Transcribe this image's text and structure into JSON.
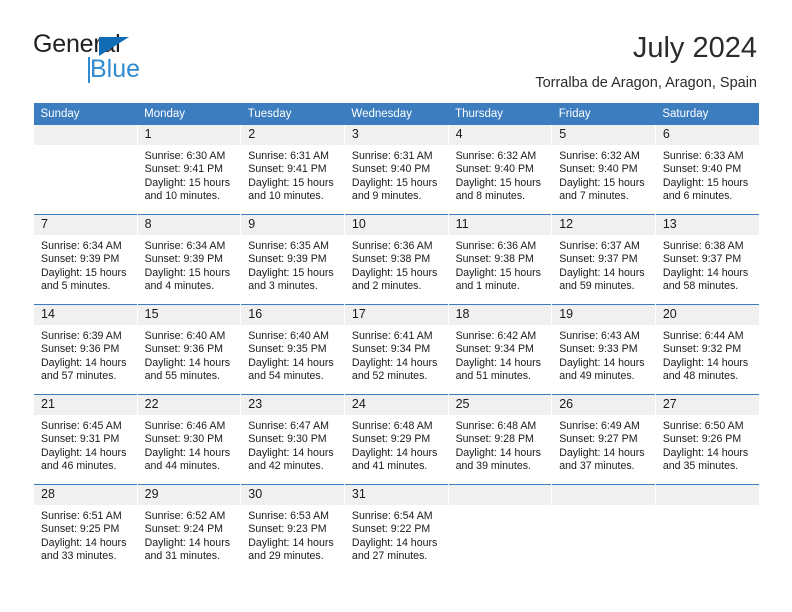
{
  "brand": {
    "name_dark": "General",
    "name_blue": "Blue",
    "accent_color": "#0f6cb5",
    "light_blue": "#2e8bd0"
  },
  "header": {
    "title": "July 2024",
    "subtitle": "Torralba de Aragon, Aragon, Spain"
  },
  "calendar": {
    "header_bg": "#3b7dbf",
    "daynum_bg": "#f0f0f0",
    "weekdays": [
      "Sunday",
      "Monday",
      "Tuesday",
      "Wednesday",
      "Thursday",
      "Friday",
      "Saturday"
    ],
    "weeks": [
      [
        {
          "day": "",
          "empty": true
        },
        {
          "day": "1",
          "sunrise": "Sunrise: 6:30 AM",
          "sunset": "Sunset: 9:41 PM",
          "daylight": "Daylight: 15 hours and 10 minutes."
        },
        {
          "day": "2",
          "sunrise": "Sunrise: 6:31 AM",
          "sunset": "Sunset: 9:41 PM",
          "daylight": "Daylight: 15 hours and 10 minutes."
        },
        {
          "day": "3",
          "sunrise": "Sunrise: 6:31 AM",
          "sunset": "Sunset: 9:40 PM",
          "daylight": "Daylight: 15 hours and 9 minutes."
        },
        {
          "day": "4",
          "sunrise": "Sunrise: 6:32 AM",
          "sunset": "Sunset: 9:40 PM",
          "daylight": "Daylight: 15 hours and 8 minutes."
        },
        {
          "day": "5",
          "sunrise": "Sunrise: 6:32 AM",
          "sunset": "Sunset: 9:40 PM",
          "daylight": "Daylight: 15 hours and 7 minutes."
        },
        {
          "day": "6",
          "sunrise": "Sunrise: 6:33 AM",
          "sunset": "Sunset: 9:40 PM",
          "daylight": "Daylight: 15 hours and 6 minutes."
        }
      ],
      [
        {
          "day": "7",
          "sunrise": "Sunrise: 6:34 AM",
          "sunset": "Sunset: 9:39 PM",
          "daylight": "Daylight: 15 hours and 5 minutes."
        },
        {
          "day": "8",
          "sunrise": "Sunrise: 6:34 AM",
          "sunset": "Sunset: 9:39 PM",
          "daylight": "Daylight: 15 hours and 4 minutes."
        },
        {
          "day": "9",
          "sunrise": "Sunrise: 6:35 AM",
          "sunset": "Sunset: 9:39 PM",
          "daylight": "Daylight: 15 hours and 3 minutes."
        },
        {
          "day": "10",
          "sunrise": "Sunrise: 6:36 AM",
          "sunset": "Sunset: 9:38 PM",
          "daylight": "Daylight: 15 hours and 2 minutes."
        },
        {
          "day": "11",
          "sunrise": "Sunrise: 6:36 AM",
          "sunset": "Sunset: 9:38 PM",
          "daylight": "Daylight: 15 hours and 1 minute."
        },
        {
          "day": "12",
          "sunrise": "Sunrise: 6:37 AM",
          "sunset": "Sunset: 9:37 PM",
          "daylight": "Daylight: 14 hours and 59 minutes."
        },
        {
          "day": "13",
          "sunrise": "Sunrise: 6:38 AM",
          "sunset": "Sunset: 9:37 PM",
          "daylight": "Daylight: 14 hours and 58 minutes."
        }
      ],
      [
        {
          "day": "14",
          "sunrise": "Sunrise: 6:39 AM",
          "sunset": "Sunset: 9:36 PM",
          "daylight": "Daylight: 14 hours and 57 minutes."
        },
        {
          "day": "15",
          "sunrise": "Sunrise: 6:40 AM",
          "sunset": "Sunset: 9:36 PM",
          "daylight": "Daylight: 14 hours and 55 minutes."
        },
        {
          "day": "16",
          "sunrise": "Sunrise: 6:40 AM",
          "sunset": "Sunset: 9:35 PM",
          "daylight": "Daylight: 14 hours and 54 minutes."
        },
        {
          "day": "17",
          "sunrise": "Sunrise: 6:41 AM",
          "sunset": "Sunset: 9:34 PM",
          "daylight": "Daylight: 14 hours and 52 minutes."
        },
        {
          "day": "18",
          "sunrise": "Sunrise: 6:42 AM",
          "sunset": "Sunset: 9:34 PM",
          "daylight": "Daylight: 14 hours and 51 minutes."
        },
        {
          "day": "19",
          "sunrise": "Sunrise: 6:43 AM",
          "sunset": "Sunset: 9:33 PM",
          "daylight": "Daylight: 14 hours and 49 minutes."
        },
        {
          "day": "20",
          "sunrise": "Sunrise: 6:44 AM",
          "sunset": "Sunset: 9:32 PM",
          "daylight": "Daylight: 14 hours and 48 minutes."
        }
      ],
      [
        {
          "day": "21",
          "sunrise": "Sunrise: 6:45 AM",
          "sunset": "Sunset: 9:31 PM",
          "daylight": "Daylight: 14 hours and 46 minutes."
        },
        {
          "day": "22",
          "sunrise": "Sunrise: 6:46 AM",
          "sunset": "Sunset: 9:30 PM",
          "daylight": "Daylight: 14 hours and 44 minutes."
        },
        {
          "day": "23",
          "sunrise": "Sunrise: 6:47 AM",
          "sunset": "Sunset: 9:30 PM",
          "daylight": "Daylight: 14 hours and 42 minutes."
        },
        {
          "day": "24",
          "sunrise": "Sunrise: 6:48 AM",
          "sunset": "Sunset: 9:29 PM",
          "daylight": "Daylight: 14 hours and 41 minutes."
        },
        {
          "day": "25",
          "sunrise": "Sunrise: 6:48 AM",
          "sunset": "Sunset: 9:28 PM",
          "daylight": "Daylight: 14 hours and 39 minutes."
        },
        {
          "day": "26",
          "sunrise": "Sunrise: 6:49 AM",
          "sunset": "Sunset: 9:27 PM",
          "daylight": "Daylight: 14 hours and 37 minutes."
        },
        {
          "day": "27",
          "sunrise": "Sunrise: 6:50 AM",
          "sunset": "Sunset: 9:26 PM",
          "daylight": "Daylight: 14 hours and 35 minutes."
        }
      ],
      [
        {
          "day": "28",
          "sunrise": "Sunrise: 6:51 AM",
          "sunset": "Sunset: 9:25 PM",
          "daylight": "Daylight: 14 hours and 33 minutes."
        },
        {
          "day": "29",
          "sunrise": "Sunrise: 6:52 AM",
          "sunset": "Sunset: 9:24 PM",
          "daylight": "Daylight: 14 hours and 31 minutes."
        },
        {
          "day": "30",
          "sunrise": "Sunrise: 6:53 AM",
          "sunset": "Sunset: 9:23 PM",
          "daylight": "Daylight: 14 hours and 29 minutes."
        },
        {
          "day": "31",
          "sunrise": "Sunrise: 6:54 AM",
          "sunset": "Sunset: 9:22 PM",
          "daylight": "Daylight: 14 hours and 27 minutes."
        },
        {
          "day": "",
          "empty": true
        },
        {
          "day": "",
          "empty": true
        },
        {
          "day": "",
          "empty": true
        }
      ]
    ]
  }
}
